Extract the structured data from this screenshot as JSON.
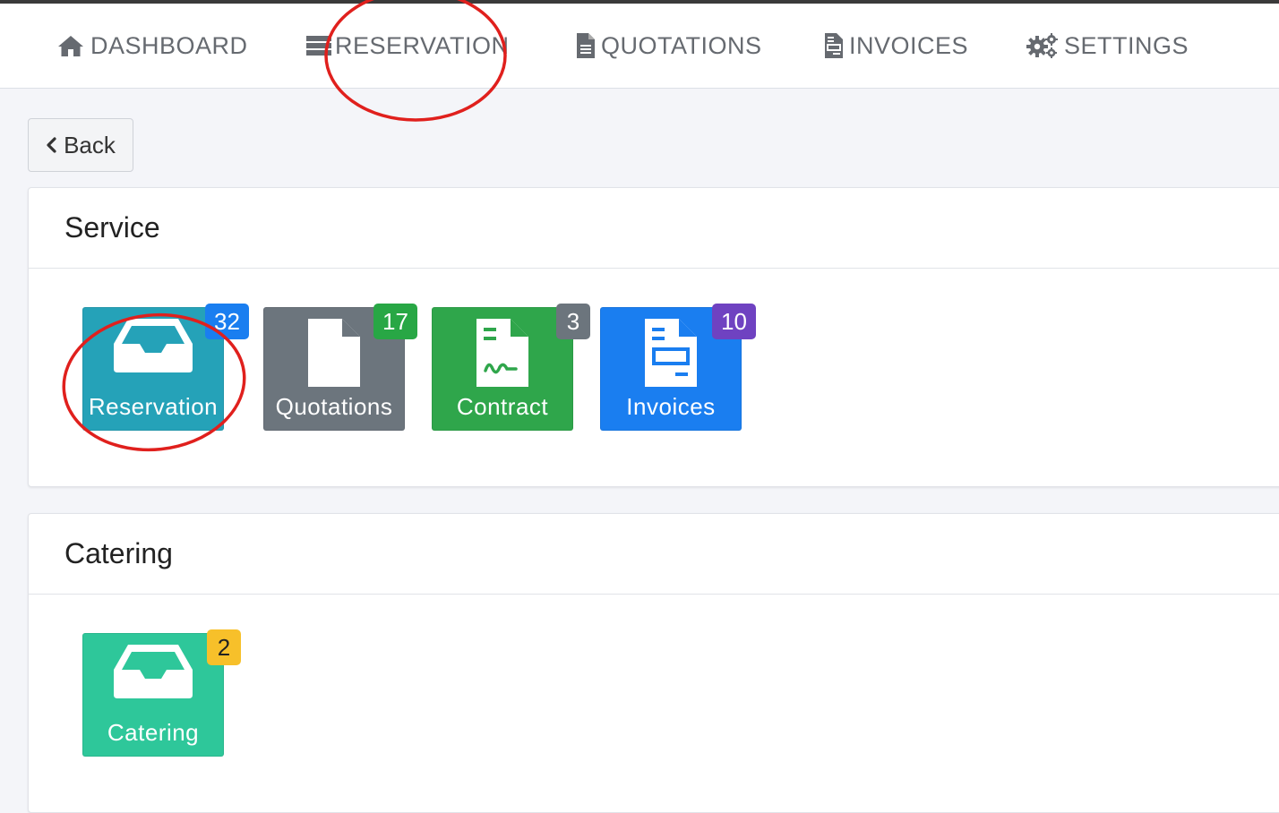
{
  "nav": {
    "items": [
      {
        "label": "DASHBOARD",
        "icon": "home-icon"
      },
      {
        "label": "RESERVATION",
        "icon": "list-icon"
      },
      {
        "label": "QUOTATIONS",
        "icon": "document-icon"
      },
      {
        "label": "INVOICES",
        "icon": "invoice-icon"
      },
      {
        "label": "SETTINGS",
        "icon": "gears-icon"
      }
    ]
  },
  "back_button": {
    "label": "Back",
    "icon": "chevron-left-icon"
  },
  "service": {
    "title": "Service",
    "tiles": [
      {
        "label": "Reservation",
        "badge": "32",
        "icon": "inbox-icon",
        "color": "#25a2b8",
        "badge_color": "#1a7ef0"
      },
      {
        "label": "Quotations",
        "badge": "17",
        "icon": "file-icon",
        "color": "#6c757d",
        "badge_color": "#28a745"
      },
      {
        "label": "Contract",
        "badge": "3",
        "icon": "contract-icon",
        "color": "#2fa64b",
        "badge_color": "#6c757d"
      },
      {
        "label": "Invoices",
        "badge": "10",
        "icon": "invoice-icon",
        "color": "#1a7ef0",
        "badge_color": "#6f42c1"
      }
    ]
  },
  "catering": {
    "title": "Catering",
    "tiles": [
      {
        "label": "Catering",
        "badge": "2",
        "icon": "inbox-icon",
        "color": "#2ec79a",
        "badge_color": "#f7c02a"
      }
    ]
  },
  "annotation_color": "#e0201d"
}
